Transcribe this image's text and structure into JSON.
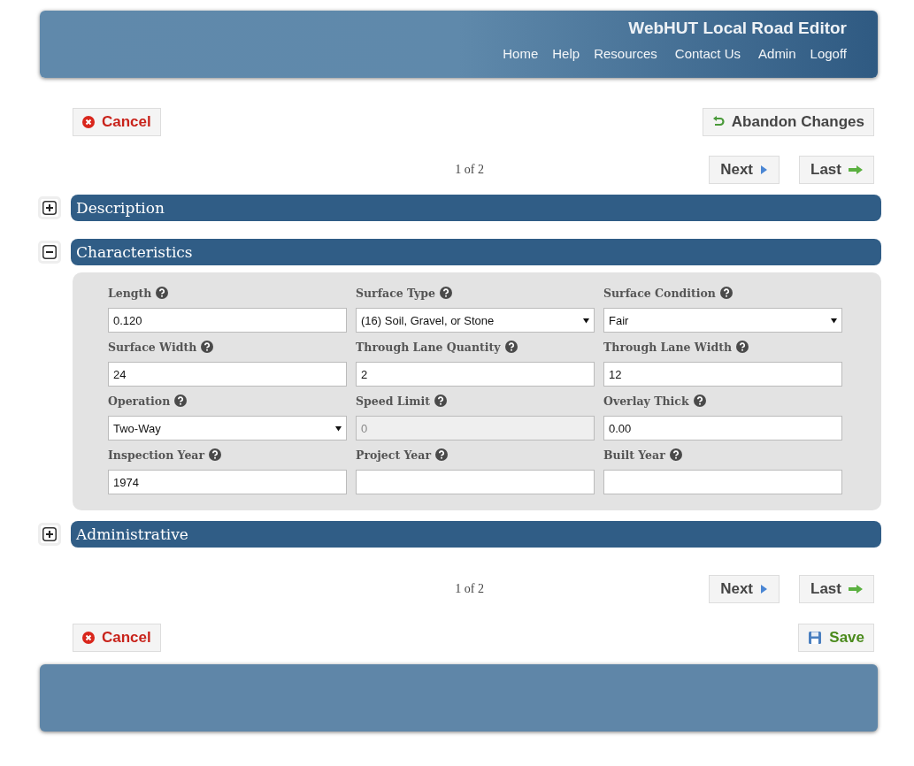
{
  "header": {
    "title": "WebHUT Local Road Editor",
    "nav": [
      "Home",
      "Help",
      "Resources",
      "Contact Us",
      "Admin",
      "Logoff"
    ]
  },
  "top_actions": {
    "cancel": "Cancel",
    "abandon": "Abandon Changes"
  },
  "top_pager": {
    "page": "1 of 2",
    "next": "Next",
    "last": "Last"
  },
  "sections": [
    {
      "title": "Description",
      "expanded": false
    },
    {
      "title": "Characteristics",
      "expanded": true,
      "fields": [
        {
          "label": "Length",
          "kind": "text",
          "value": "0.120",
          "disabled": false
        },
        {
          "label": "Surface Type",
          "kind": "select",
          "value": "(16) Soil, Gravel, or Stone",
          "disabled": false
        },
        {
          "label": "Surface Condition",
          "kind": "select",
          "value": "Fair",
          "disabled": false
        },
        {
          "label": "Surface Width",
          "kind": "text",
          "value": "24",
          "disabled": false
        },
        {
          "label": "Through Lane Quantity",
          "kind": "text",
          "value": "2",
          "disabled": false
        },
        {
          "label": "Through Lane Width",
          "kind": "text",
          "value": "12",
          "disabled": false
        },
        {
          "label": "Operation",
          "kind": "select",
          "value": "Two-Way",
          "disabled": false
        },
        {
          "label": "Speed Limit",
          "kind": "text",
          "value": "0",
          "disabled": true
        },
        {
          "label": "Overlay Thick",
          "kind": "text",
          "value": "0.00",
          "disabled": false
        },
        {
          "label": "Inspection Year",
          "kind": "text",
          "value": "1974",
          "disabled": false
        },
        {
          "label": "Project Year",
          "kind": "text",
          "disabled": false
        },
        {
          "label": "Built Year",
          "kind": "text",
          "disabled": false
        }
      ]
    },
    {
      "title": "Administrative",
      "expanded": false
    }
  ],
  "bottom_pager": {
    "page": "1 of 2",
    "next": "Next",
    "last": "Last"
  },
  "bottom_actions": {
    "cancel": "Cancel",
    "save": "Save"
  }
}
